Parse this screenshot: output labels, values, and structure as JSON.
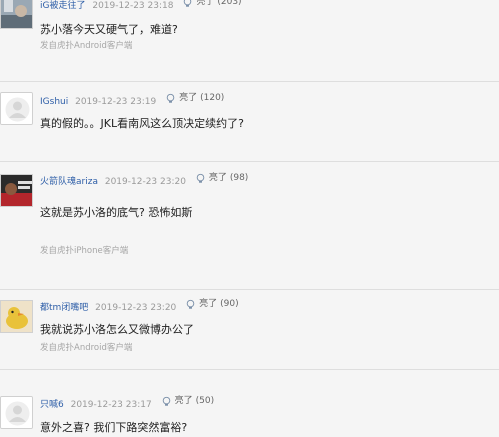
{
  "comments": [
    {
      "username": "iG被走往了",
      "time": "2019-12-23 23:18",
      "light_label": "亮了",
      "light_count": "(203)",
      "text": "苏小落今天又硬气了，难道?",
      "source": "发自虎扑Android客户端",
      "avatar_icon": "avatar-photo-icon"
    },
    {
      "username": "IGshui",
      "time": "2019-12-23 23:19",
      "light_label": "亮了",
      "light_count": "(120)",
      "text": "真的假的。。JKL看南风这么顶决定续约了?",
      "source": "",
      "avatar_icon": "default-avatar-icon"
    },
    {
      "username": "火箭队魂ariza",
      "time": "2019-12-23 23:20",
      "light_label": "亮了",
      "light_count": "(98)",
      "text": "这就是苏小洛的底气? 恐怖如斯",
      "source": "发自虎扑iPhone客户端",
      "avatar_icon": "avatar-photo-icon"
    },
    {
      "username": "都tm闭嘴吧",
      "time": "2019-12-23 23:20",
      "light_label": "亮了",
      "light_count": "(90)",
      "text": "我就说苏小洛怎么又微博办公了",
      "source": "发自虎扑Android客户端",
      "avatar_icon": "avatar-duck-icon"
    },
    {
      "username": "只喊6",
      "time": "2019-12-23 23:17",
      "light_label": "亮了",
      "light_count": "(50)",
      "text": "意外之喜? 我们下路突然富裕?",
      "source": "",
      "avatar_icon": "default-avatar-icon"
    }
  ],
  "colors": {
    "username": "#2f5fa8",
    "meta": "#9a9a9a",
    "text": "#222222",
    "source": "#a6a6a6"
  }
}
